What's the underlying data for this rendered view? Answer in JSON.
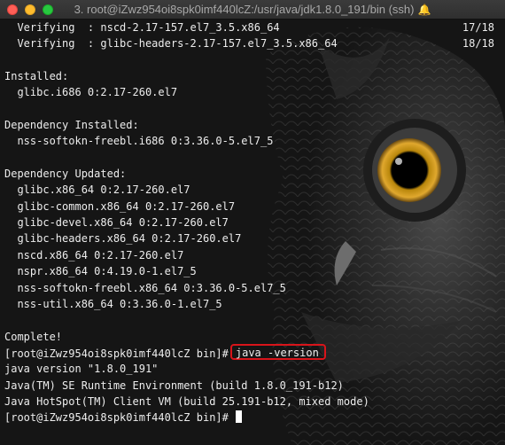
{
  "window": {
    "title": "3. root@iZwz954oi8spk0imf440lcZ:/usr/java/jdk1.8.0_191/bin (ssh)",
    "bell": "🔔"
  },
  "terminal": {
    "lines": [
      {
        "text": "  Verifying  : nscd-2.17-157.el7_3.5.x86_64",
        "right": "17/18"
      },
      {
        "text": "  Verifying  : glibc-headers-2.17-157.el7_3.5.x86_64",
        "right": "18/18"
      },
      {
        "text": "",
        "right": ""
      },
      {
        "text": "Installed:",
        "right": ""
      },
      {
        "text": "  glibc.i686 0:2.17-260.el7",
        "right": ""
      },
      {
        "text": "",
        "right": ""
      },
      {
        "text": "Dependency Installed:",
        "right": ""
      },
      {
        "text": "  nss-softokn-freebl.i686 0:3.36.0-5.el7_5",
        "right": ""
      },
      {
        "text": "",
        "right": ""
      },
      {
        "text": "Dependency Updated:",
        "right": ""
      },
      {
        "text": "  glibc.x86_64 0:2.17-260.el7",
        "right": ""
      },
      {
        "text": "  glibc-common.x86_64 0:2.17-260.el7",
        "right": ""
      },
      {
        "text": "  glibc-devel.x86_64 0:2.17-260.el7",
        "right": ""
      },
      {
        "text": "  glibc-headers.x86_64 0:2.17-260.el7",
        "right": ""
      },
      {
        "text": "  nscd.x86_64 0:2.17-260.el7",
        "right": ""
      },
      {
        "text": "  nspr.x86_64 0:4.19.0-1.el7_5",
        "right": ""
      },
      {
        "text": "  nss-softokn-freebl.x86_64 0:3.36.0-5.el7_5",
        "right": ""
      },
      {
        "text": "  nss-util.x86_64 0:3.36.0-1.el7_5",
        "right": ""
      },
      {
        "text": "",
        "right": ""
      },
      {
        "text": "Complete!",
        "right": ""
      }
    ],
    "highlighted_prompt": {
      "prompt": "[root@iZwz954oi8spk0imf440lcZ bin]#",
      "command": "java -version"
    },
    "output_lines": [
      "java version \"1.8.0_191\"",
      "Java(TM) SE Runtime Environment (build 1.8.0_191-b12)",
      "Java HotSpot(TM) Client VM (build 25.191-b12, mixed mode)"
    ],
    "final_prompt": "[root@iZwz954oi8spk0imf440lcZ bin]#",
    "highlight_color": "#d8141a"
  }
}
